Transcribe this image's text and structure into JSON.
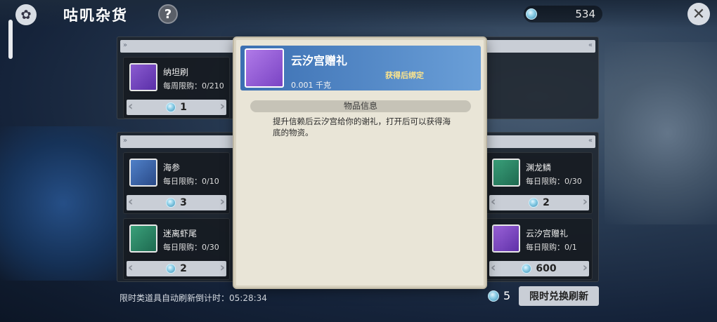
{
  "header": {
    "title": "咕叽杂货",
    "help_label": "?",
    "currency_value": "534",
    "close_label": "✕"
  },
  "shop": {
    "weekly_items": [
      {
        "name": "纳坦刷",
        "limit": "每周限购：0/210",
        "price": "1",
        "icon": "broom-icon"
      }
    ],
    "daily_items_left": [
      {
        "name": "海参",
        "limit": "每日限购：0/10",
        "price": "3",
        "icon": "sea-cucumber-icon"
      },
      {
        "name": "迷离虾尾",
        "limit": "每日限购：0/30",
        "price": "2",
        "icon": "shrimp-tail-icon"
      }
    ],
    "daily_items_right": [
      {
        "name": "渊龙鳞",
        "limit": "每日限购：0/30",
        "price": "2",
        "icon": "dragon-scale-icon"
      },
      {
        "name": "云汐宫赠礼",
        "limit": "每日限购：0/1",
        "price": "600",
        "icon": "conch-shell-icon"
      }
    ],
    "refresh_timer": "限时类道具自动刷新倒计时：05:28:34",
    "refresh_cost": "5",
    "refresh_button": "限时兑换刷新"
  },
  "modal": {
    "title": "云汐宫赠礼",
    "bind_status": "获得后绑定",
    "weight": "0.001 千克",
    "section_label": "物品信息",
    "description": "提升信赖后云汐宫给你的谢礼，打开后可以获得海底的物资。",
    "icon": "conch-shell-icon"
  }
}
